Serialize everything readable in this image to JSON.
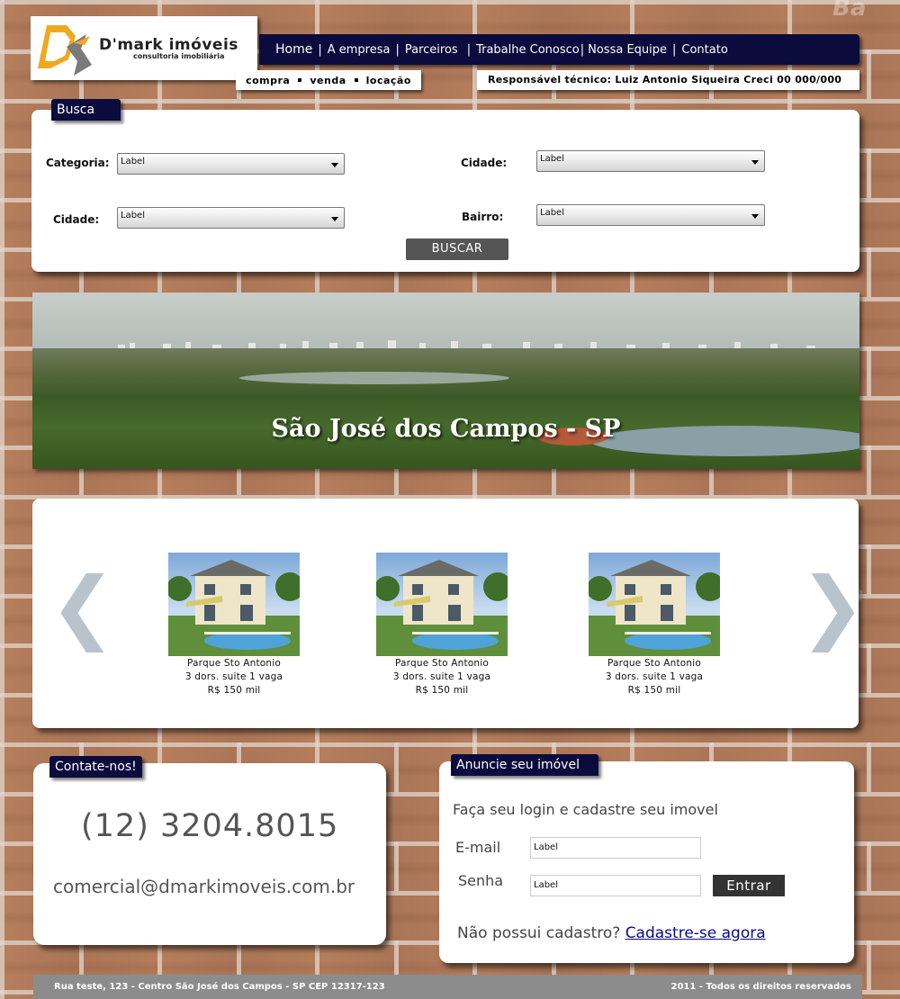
{
  "header": {
    "logo_main": "D'mark imóveis",
    "logo_sub": "consultoria imobiliária",
    "nav": [
      "Home",
      "A empresa",
      "Parceiros",
      "Trabalhe Conosco",
      "Nossa Equipe",
      "Contato"
    ],
    "subnav": [
      "compra",
      "venda",
      "locação"
    ],
    "responsavel": "Responsável técnico: Luiz Antonio Siqueira Creci 00 000/000"
  },
  "search": {
    "title": "Busca",
    "label_categoria": "Categoria:",
    "label_cidade1": "Cidade:",
    "label_cidade2": "Cidade:",
    "label_bairro": "Bairro:",
    "value_categoria": "Label",
    "value_cidade1": "Label",
    "value_cidade2": "Label",
    "value_bairro": "Label",
    "button": "BUSCAR"
  },
  "banner": {
    "title": "São José dos Campos - SP"
  },
  "listings": [
    {
      "name": "Parque Sto Antonio",
      "desc": "3 dors. suite 1 vaga",
      "price": "R$ 150 mil"
    },
    {
      "name": "Parque Sto Antonio",
      "desc": "3 dors. suite 1 vaga",
      "price": "R$ 150 mil"
    },
    {
      "name": "Parque Sto Antonio",
      "desc": "3 dors. suite 1 vaga",
      "price": "R$ 150 mil"
    }
  ],
  "carousel": {
    "prev": "❮",
    "next": "❯"
  },
  "contact": {
    "title": "Contate-nos!",
    "phone": "(12) 3204.8015",
    "email": "comercial@dmarkimoveis.com.br"
  },
  "advertise": {
    "title": "Anuncie seu imóvel",
    "heading": "Faça seu login e cadastre seu imovel",
    "email_label": "E-mail",
    "email_value": "Label",
    "password_label": "Senha",
    "password_value": "Label",
    "button": "Entrar",
    "no_account": "Não possui cadastro?",
    "signup_link": "Cadastre-se agora"
  },
  "footer": {
    "address": "Rua teste, 123 - Centro São José dos Campos - SP CEP 12317-123",
    "rights": "2011 - Todos os direitos reservados"
  },
  "colors": {
    "nav_bg": "#0b0b3d",
    "logo_orange": "#f0a81c",
    "footer_bg": "#8c8c8c",
    "link": "#0a0a8a"
  },
  "icons": [
    "chevron-left-icon",
    "chevron-right-icon"
  ]
}
